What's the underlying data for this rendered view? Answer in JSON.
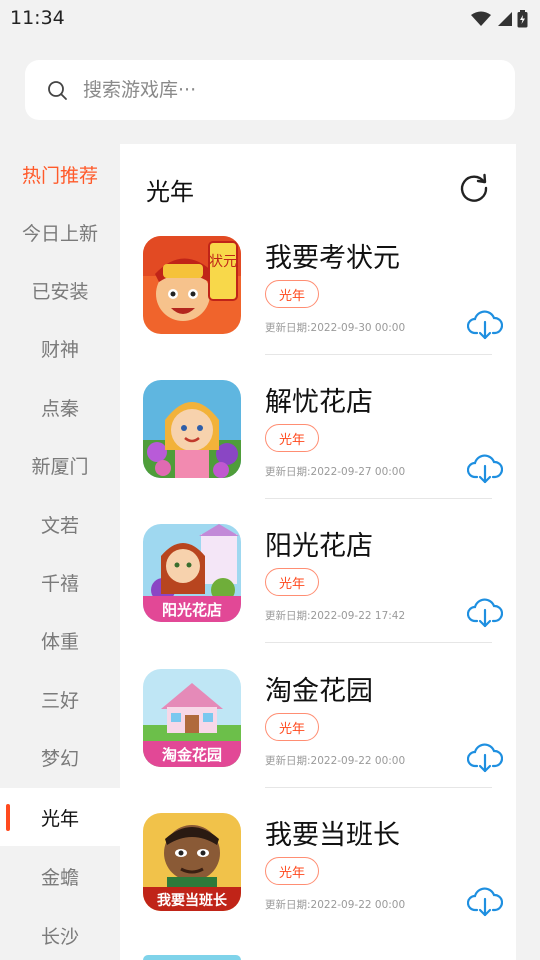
{
  "status": {
    "time": "11:34"
  },
  "search": {
    "placeholder": "搜索游戏库···"
  },
  "sidebar": {
    "items": [
      {
        "label": "热门推荐"
      },
      {
        "label": "今日上新"
      },
      {
        "label": "已安装"
      },
      {
        "label": "财神"
      },
      {
        "label": "点秦"
      },
      {
        "label": "新厦门"
      },
      {
        "label": "文若"
      },
      {
        "label": "千禧"
      },
      {
        "label": "体重"
      },
      {
        "label": "三好"
      },
      {
        "label": "梦幻"
      },
      {
        "label": "光年"
      },
      {
        "label": "金蟾"
      },
      {
        "label": "长沙"
      }
    ]
  },
  "panel": {
    "title": "光年",
    "games": [
      {
        "name": "我要考状元",
        "tag": "光年",
        "date": "更新日期:2022-09-30 00:00",
        "icon_text": "状元"
      },
      {
        "name": "解忧花店",
        "tag": "光年",
        "date": "更新日期:2022-09-27 00:00",
        "icon_text": ""
      },
      {
        "name": "阳光花店",
        "tag": "光年",
        "date": "更新日期:2022-09-22 17:42",
        "icon_text": "阳光花店"
      },
      {
        "name": "淘金花园",
        "tag": "光年",
        "date": "更新日期:2022-09-22 00:00",
        "icon_text": "淘金花园"
      },
      {
        "name": "我要当班长",
        "tag": "光年",
        "date": "更新日期:2022-09-22 00:00",
        "icon_text": "我要当班长"
      }
    ]
  },
  "colors": {
    "accent": "#ff4a1e",
    "download": "#1e8fe0",
    "background": "#f2f2f2"
  }
}
